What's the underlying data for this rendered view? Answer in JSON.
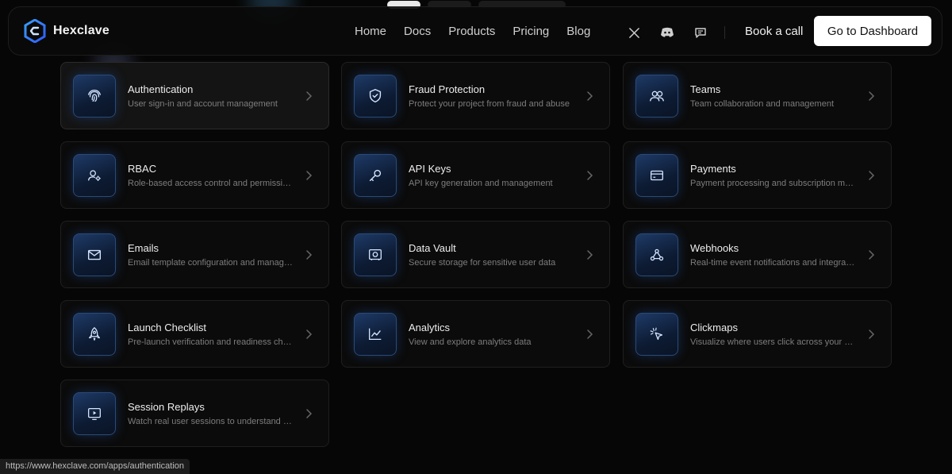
{
  "brand": {
    "name": "Hexclave"
  },
  "nav": {
    "links": [
      "Home",
      "Docs",
      "Products",
      "Pricing",
      "Blog"
    ],
    "icons": [
      "x-icon",
      "discord-icon",
      "chat-icon"
    ],
    "book_call": "Book a call",
    "dashboard": "Go to Dashboard"
  },
  "apps": [
    {
      "title": "Authentication",
      "desc": "User sign-in and account management",
      "icon": "fingerprint-icon",
      "active": true
    },
    {
      "title": "Fraud Protection",
      "desc": "Protect your project from fraud and abuse",
      "icon": "shield-check-icon"
    },
    {
      "title": "Teams",
      "desc": "Team collaboration and management",
      "icon": "users-icon"
    },
    {
      "title": "RBAC",
      "desc": "Role-based access control and permissions",
      "icon": "user-cog-icon"
    },
    {
      "title": "API Keys",
      "desc": "API key generation and management",
      "icon": "key-icon"
    },
    {
      "title": "Payments",
      "desc": "Payment processing and subscription management",
      "icon": "credit-card-icon"
    },
    {
      "title": "Emails",
      "desc": "Email template configuration and management",
      "icon": "mail-icon"
    },
    {
      "title": "Data Vault",
      "desc": "Secure storage for sensitive user data",
      "icon": "vault-icon"
    },
    {
      "title": "Webhooks",
      "desc": "Real-time event notifications and integrations",
      "icon": "webhook-icon"
    },
    {
      "title": "Launch Checklist",
      "desc": "Pre-launch verification and readiness checks",
      "icon": "rocket-icon"
    },
    {
      "title": "Analytics",
      "desc": "View and explore analytics data",
      "icon": "chart-line-icon"
    },
    {
      "title": "Clickmaps",
      "desc": "Visualize where users click across your app",
      "icon": "cursor-click-icon"
    },
    {
      "title": "Session Replays",
      "desc": "Watch real user sessions to understand behavior",
      "icon": "play-screen-icon"
    }
  ],
  "status_url": "https://www.hexclave.com/apps/authentication"
}
